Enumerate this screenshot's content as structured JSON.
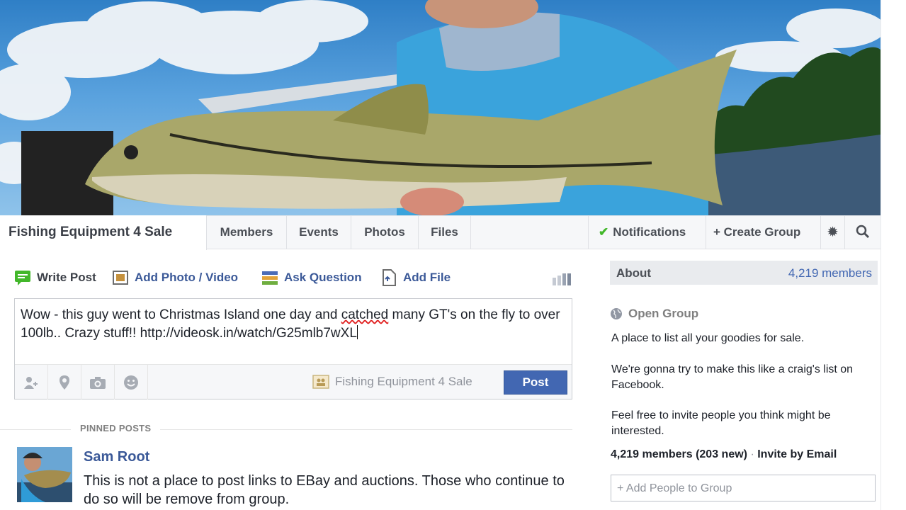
{
  "group": {
    "name": "Fishing Equipment 4 Sale"
  },
  "nav": {
    "tabs": [
      {
        "label": "Members"
      },
      {
        "label": "Events"
      },
      {
        "label": "Photos"
      },
      {
        "label": "Files"
      }
    ],
    "notifications_label": "Notifications",
    "create_group_label": "+ Create Group",
    "icons": {
      "settings": "gear-icon",
      "search": "search-icon",
      "check": "check-icon"
    }
  },
  "composer": {
    "tabs": {
      "write_post": "Write Post",
      "add_photo": "Add Photo / Video",
      "ask_question": "Ask Question",
      "add_file": "Add File"
    },
    "text_part1": "Wow - this guy went to Christmas Island one day and ",
    "text_misspelled": "catched",
    "text_part2": " many GT's on the fly to over 100lb.. Crazy stuff!! http://videosk.in/watch/G25mlb7wXL",
    "footer_icons": [
      "tag-people-icon",
      "location-icon",
      "camera-icon",
      "emoji-icon"
    ],
    "audience": "Fishing Equipment 4 Sale",
    "post_label": "Post"
  },
  "pinned": {
    "label": "PINNED POSTS",
    "author": "Sam Root",
    "body": "This is not a place to post links to EBay and auctions. Those who continue to do so will be remove from group."
  },
  "sidebar": {
    "about_label": "About",
    "member_count": "4,219 members",
    "open_group": "Open Group",
    "desc1": "A place to list all your goodies for sale.",
    "desc2": "We're gonna try to make this like a craig's list on Facebook.",
    "desc3": "Feel free to invite people you think might be interested.",
    "members_summary": "4,219 members (203 new)",
    "separator": "·",
    "invite_label": "Invite by Email",
    "add_people_placeholder": "+ Add People to Group"
  },
  "colors": {
    "brand_blue": "#3b5998",
    "button_blue": "#4267b2",
    "check_green": "#42b72a"
  }
}
